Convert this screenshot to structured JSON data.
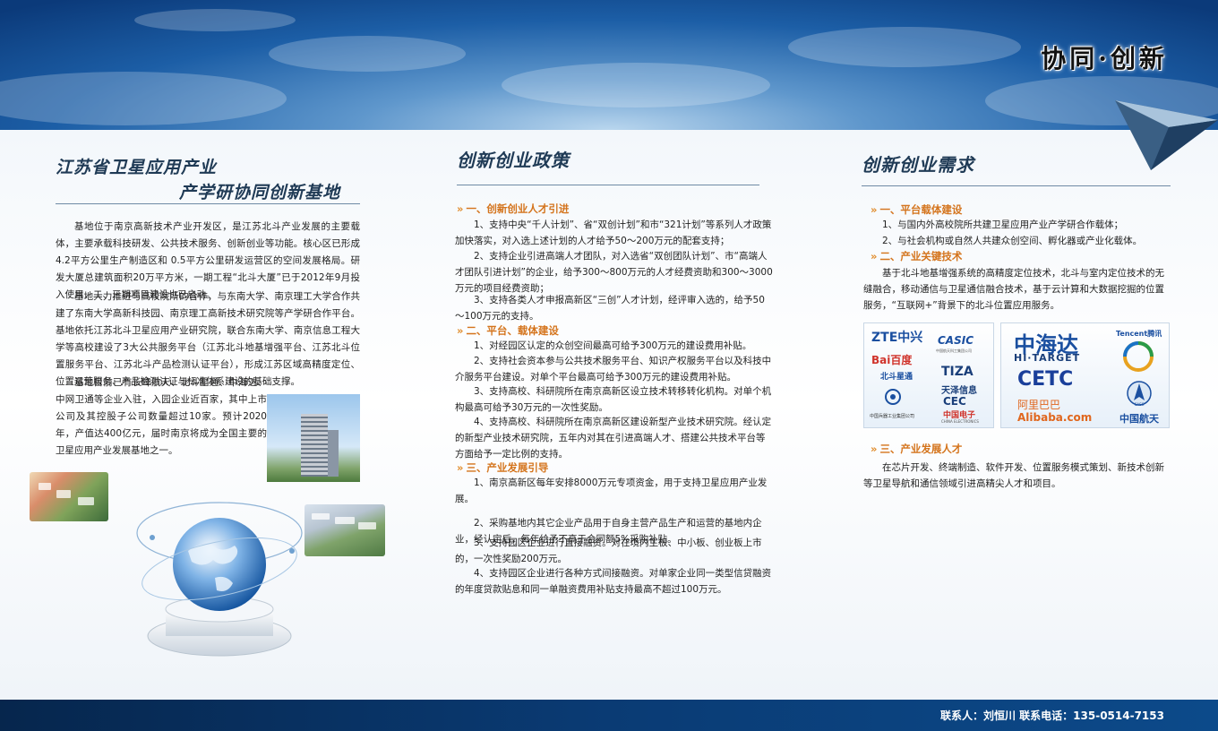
{
  "banner": {
    "slogan": "协同·创新"
  },
  "left": {
    "title_line1": "江苏省卫星应用产业",
    "title_line2": "产学研协同创新基地",
    "paragraphs": [
      "基地位于南京高新技术产业开发区，是江苏北斗产业发展的主要载体，主要承载科技研发、公共技术服务、创新创业等功能。核心区已形成4.2平方公里生产制造区和 0.5平方公里研发运营区的空间发展格局。研发大厦总建筑面积20万平方米，一期工程“北斗大厦”已于2012年9月投入使用，二、三期项目建设也已启动。",
      "基地大力推进与高校院所的合作，与东南大学、南京理工大学合作共建了东南大学高新科技园、南京理工高新技术研究院等产学研合作平台。基地依托江苏北斗卫星应用产业研究院，联合东南大学、南京信息工程大学等高校建设了3大公共服务平台（江苏北斗地基增强平台、江苏北斗位置服务平台、江苏北斗产品检测认证平台），形成江苏区域高精度定位、位置运营服务、产品检测认证与标准体系建设的基础支撑。",
      "基地目前已有长峰航天、北斗星通、中海达、中网卫通等企业入驻，入园企业近百家，其中上市公司及其控股子公司数量超过10家。预计2020年，产值达400亿元，届时南京将成为全国主要的卫星应用产业发展基地之一。"
    ]
  },
  "middle": {
    "title": "创新创业政策",
    "sections": [
      {
        "heading": "一、创新创业人才引进",
        "items": [
          "1、支持中央“千人计划”、省“双创计划”和市“321计划”等系列人才政策加快落实，对入选上述计划的人才给予50～200万元的配套支持；",
          "2、支持企业引进高端人才团队，对入选省“双创团队计划”、市“高端人才团队引进计划”的企业，给予300～800万元的人才经费资助和300～3000万元的项目经费资助；",
          "3、支持各类人才申报高新区“三创”人才计划，经评审入选的，给予50～100万元的支持。"
        ]
      },
      {
        "heading": "二、平台、载体建设",
        "items": [
          "1、对经园区认定的众创空间最高可给予300万元的建设费用补贴。",
          "2、支持社会资本参与公共技术服务平台、知识产权服务平台以及科技中介服务平台建设。对单个平台最高可给予300万元的建设费用补贴。",
          "3、支持高校、科研院所在南京高新区设立技术转移转化机构。对单个机构最高可给予30万元的一次性奖励。",
          "4、支持高校、科研院所在南京高新区建设新型产业技术研究院。经认定的新型产业技术研究院，五年内对其在引进高端人才、搭建公共技术平台等方面给予一定比例的支持。"
        ]
      },
      {
        "heading": "三、产业发展引导",
        "items": [
          "1、南京高新区每年安排8000万元专项资金，用于支持卫星应用产业发展。",
          "2、采购基地内其它企业产品用于自身主营产品生产和运营的基地内企业，经认定后，每年给予不高于合同额5%采购补贴。",
          "3、支持园区企业进行直接融资。对在境内主板、中小板、创业板上市的，一次性奖励200万元。",
          "4、支持园区企业进行各种方式间接融资。对单家企业同一类型信贷融资的年度贷款贴息和同一单融资费用补贴支持最高不超过100万元。"
        ]
      }
    ]
  },
  "right": {
    "title": "创新创业需求",
    "sections": [
      {
        "heading": "一、平台载体建设",
        "items": [
          "1、与国内外高校院所共建卫星应用产业产学研合作载体；",
          "2、与社会机构或自然人共建众创空间、孵化器或产业化载体。"
        ]
      },
      {
        "heading": "二、产业关键技术",
        "items": [
          "基于北斗地基增强系统的高精度定位技术，北斗与室内定位技术的无缝融合，移动通信与卫星通信融合技术，基于云计算和大数据挖掘的位置服务，“互联网+”背景下的北斗位置应用服务。"
        ]
      },
      {
        "heading": "三、产业发展人才",
        "items": [
          "在芯片开发、终端制造、软件开发、位置服务模式策划、新技术创新等卫星导航和通信领域引进高精尖人才和项目。"
        ]
      }
    ],
    "logos_box1": {
      "zte": "ZTE中兴",
      "casic": "CASIC",
      "casic_sub": "中国航天科工集团公司",
      "baidu": "Bai百度",
      "beidou": "北斗星通",
      "tiza_en": "TIZA",
      "tiza_cn": "天泽信息",
      "cec_en": "CEC",
      "cec_cn": "中国电子",
      "cec_sub": "CHINA ELECTRONICS",
      "cast_text": "中国兵器工业集团公司"
    },
    "logos_box2": {
      "hitarget_cn": "中海达",
      "hitarget_en": "HI·TARGET",
      "tencent": "Tencent腾讯",
      "cetc": "CETC",
      "alibaba_cn": "阿里巴巴",
      "alibaba_en": "Alibaba.com",
      "casc_cn": "中国航天",
      "casc_mark": "CASC"
    }
  },
  "footer": {
    "contact": "联系人：刘恒川    联系电话：135-0514-7153"
  },
  "colors": {
    "accent": "#d4741c",
    "title": "#1f3a55",
    "footer": "#0a3b74"
  }
}
